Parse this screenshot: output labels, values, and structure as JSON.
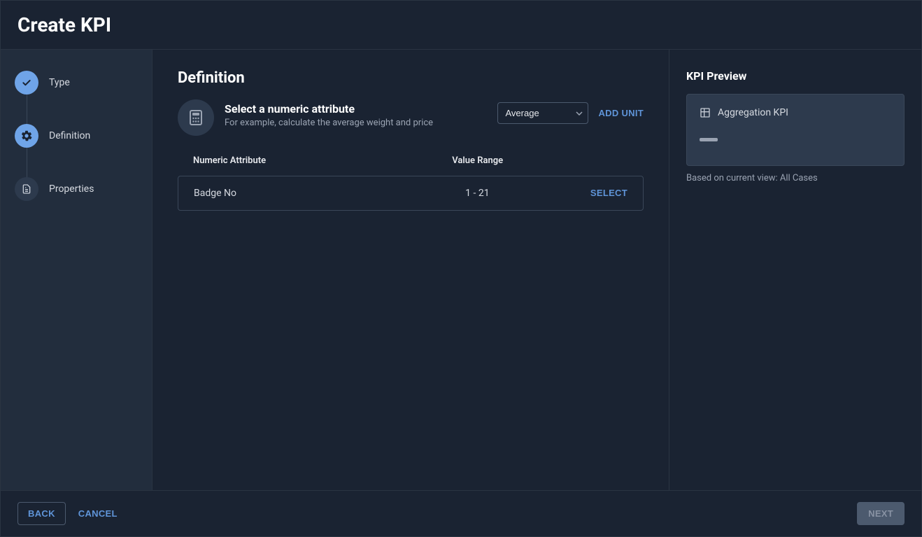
{
  "header": {
    "title": "Create KPI"
  },
  "sidebar": {
    "steps": [
      {
        "label": "Type",
        "state": "done"
      },
      {
        "label": "Definition",
        "state": "active"
      },
      {
        "label": "Properties",
        "state": "pending"
      }
    ]
  },
  "main": {
    "section_title": "Definition",
    "def_title": "Select a numeric attribute",
    "def_subtitle": "For example, calculate the average weight and price",
    "aggregation_value": "Average",
    "add_unit_label": "ADD UNIT",
    "columns": {
      "name": "Numeric Attribute",
      "range": "Value Range"
    },
    "rows": [
      {
        "name": "Badge No",
        "range": "1 - 21",
        "action": "SELECT"
      }
    ]
  },
  "preview": {
    "title": "KPI Preview",
    "kpi_label": "Aggregation KPI",
    "footer": "Based on current view: All Cases"
  },
  "footer": {
    "back": "BACK",
    "cancel": "CANCEL",
    "next": "NEXT"
  }
}
